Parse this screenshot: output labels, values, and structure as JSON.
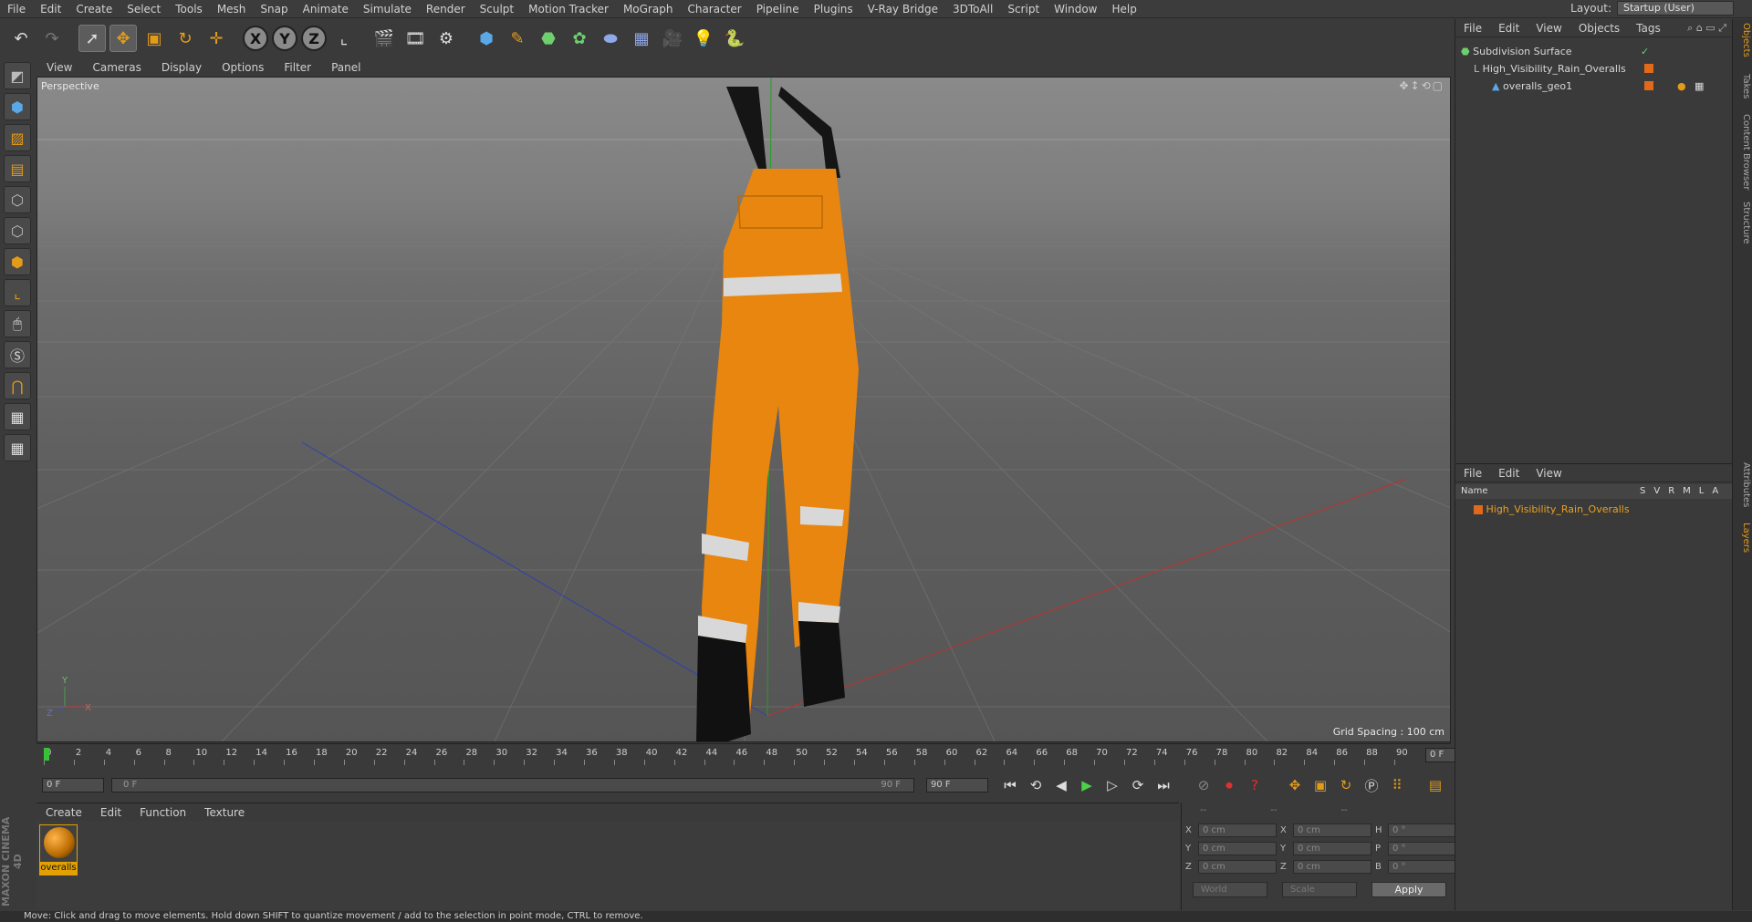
{
  "menu": [
    "File",
    "Edit",
    "Create",
    "Select",
    "Tools",
    "Mesh",
    "Snap",
    "Animate",
    "Simulate",
    "Render",
    "Sculpt",
    "Motion Tracker",
    "MoGraph",
    "Character",
    "Pipeline",
    "Plugins",
    "V-Ray Bridge",
    "3DToAll",
    "Script",
    "Window",
    "Help"
  ],
  "layout": {
    "label": "Layout:",
    "value": "Startup (User)"
  },
  "viewport": {
    "menu": [
      "View",
      "Cameras",
      "Display",
      "Options",
      "Filter",
      "Panel"
    ],
    "label": "Perspective",
    "grid_spacing": "Grid Spacing : 100 cm"
  },
  "timeline": {
    "ticks": [
      "0",
      "2",
      "4",
      "6",
      "8",
      "10",
      "12",
      "14",
      "16",
      "18",
      "20",
      "22",
      "24",
      "26",
      "28",
      "30",
      "32",
      "34",
      "36",
      "38",
      "40",
      "42",
      "44",
      "46",
      "48",
      "50",
      "52",
      "54",
      "56",
      "58",
      "60",
      "62",
      "64",
      "66",
      "68",
      "70",
      "72",
      "74",
      "76",
      "78",
      "80",
      "82",
      "84",
      "86",
      "88",
      "90"
    ],
    "frame_display": "0 F",
    "start_field": "0 F",
    "slider_start": "0 F",
    "slider_end": "90 F",
    "end_field": "90 F"
  },
  "materials": {
    "menu": [
      "Create",
      "Edit",
      "Function",
      "Texture"
    ],
    "items": [
      {
        "name": "overalls"
      }
    ]
  },
  "coords": {
    "headers": [
      "--",
      "--",
      "--"
    ],
    "rows": [
      {
        "a": "X",
        "av": "0 cm",
        "b": "X",
        "bv": "0 cm",
        "c": "H",
        "cv": "0 °"
      },
      {
        "a": "Y",
        "av": "0 cm",
        "b": "Y",
        "bv": "0 cm",
        "c": "P",
        "cv": "0 °"
      },
      {
        "a": "Z",
        "av": "0 cm",
        "b": "Z",
        "bv": "0 cm",
        "c": "B",
        "cv": "0 °"
      }
    ],
    "space": "World",
    "mode": "Scale",
    "apply": "Apply"
  },
  "objects": {
    "menu": [
      "File",
      "Edit",
      "View",
      "Objects",
      "Tags"
    ],
    "tree": [
      {
        "name": "Subdivision Surface",
        "indent": 0
      },
      {
        "name": "High_Visibility_Rain_Overalls",
        "indent": 1
      },
      {
        "name": "overalls_geo1",
        "indent": 2
      }
    ]
  },
  "layers": {
    "menu": [
      "File",
      "Edit",
      "View"
    ],
    "header": {
      "name": "Name",
      "cols": [
        "S",
        "V",
        "R",
        "M",
        "L",
        "A"
      ]
    },
    "items": [
      {
        "name": "High_Visibility_Rain_Overalls"
      }
    ]
  },
  "right_tabs": [
    "Objects",
    "Takes",
    "Content Browser",
    "Structure",
    "Attributes",
    "Layers"
  ],
  "status": "Move: Click and drag to move elements. Hold down SHIFT to quantize movement / add to the selection in point mode, CTRL to remove.",
  "branding": "MAXON CINEMA 4D",
  "colors": {
    "accent": "#e2a100",
    "layer": "#e06a1a",
    "overalls_orange": "#e8860f"
  }
}
